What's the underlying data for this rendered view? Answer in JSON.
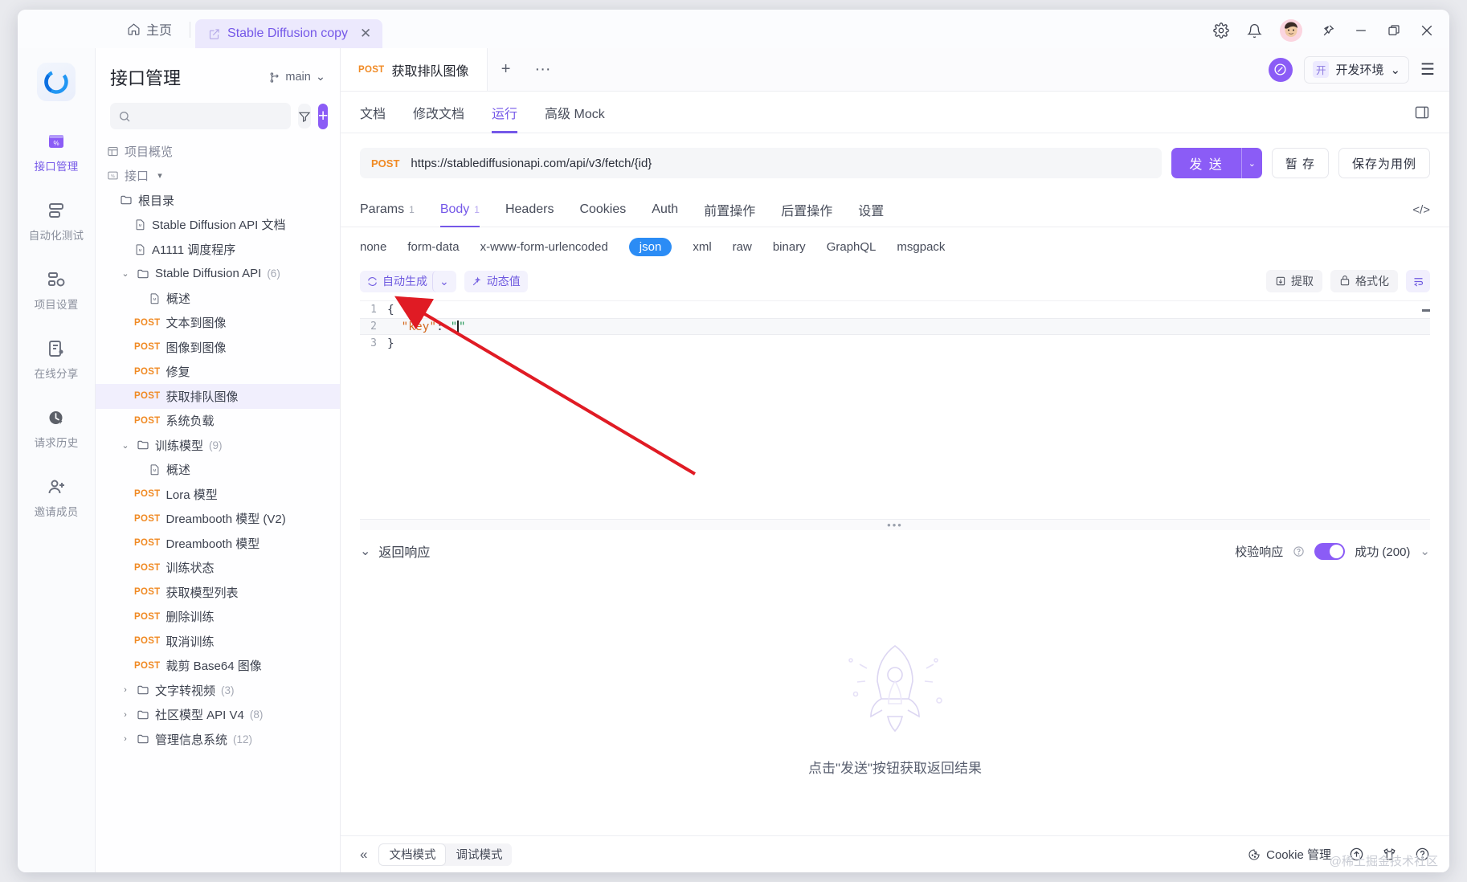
{
  "titlebar": {
    "home_tab": "主页",
    "doc_tab": "Stable Diffusion copy",
    "close_glyph": "✕",
    "icons": [
      "gear-icon",
      "bell-icon",
      "avatar",
      "pin-icon",
      "minimize-icon",
      "restore-icon",
      "close-icon"
    ]
  },
  "rail": {
    "items": [
      {
        "label": "接口管理",
        "icon": "api-manage-icon",
        "active": true
      },
      {
        "label": "自动化测试",
        "icon": "automation-test-icon",
        "active": false
      },
      {
        "label": "项目设置",
        "icon": "project-settings-icon",
        "active": false
      },
      {
        "label": "在线分享",
        "icon": "online-share-icon",
        "active": false
      },
      {
        "label": "请求历史",
        "icon": "request-history-icon",
        "active": false
      },
      {
        "label": "邀请成员",
        "icon": "invite-member-icon",
        "active": false
      }
    ]
  },
  "tree": {
    "title": "接口管理",
    "branch": "main",
    "search_placeholder": "",
    "search_value": "",
    "overview_label": "项目概览",
    "interface_label": "接口",
    "nodes": [
      {
        "type": "folder",
        "label": "根目录",
        "indent": 2,
        "caret": "",
        "count": ""
      },
      {
        "type": "doc",
        "label": "Stable Diffusion API 文档",
        "indent": 3,
        "caret": "",
        "count": ""
      },
      {
        "type": "doc",
        "label": "A1111 调度程序",
        "indent": 3,
        "caret": "",
        "count": ""
      },
      {
        "type": "folder",
        "label": "Stable Diffusion API",
        "indent": 2,
        "caret": "⌄",
        "count": "(6)"
      },
      {
        "type": "doc",
        "label": "概述",
        "indent": 4,
        "caret": "",
        "count": ""
      },
      {
        "type": "api",
        "label": "文本到图像",
        "indent": 3,
        "method": "POST",
        "count": ""
      },
      {
        "type": "api",
        "label": "图像到图像",
        "indent": 3,
        "method": "POST",
        "count": ""
      },
      {
        "type": "api",
        "label": "修复",
        "indent": 3,
        "method": "POST",
        "count": ""
      },
      {
        "type": "api",
        "label": "获取排队图像",
        "indent": 3,
        "method": "POST",
        "count": "",
        "selected": true
      },
      {
        "type": "api",
        "label": "系统负载",
        "indent": 3,
        "method": "POST",
        "count": ""
      },
      {
        "type": "folder",
        "label": "训练模型",
        "indent": 2,
        "caret": "⌄",
        "count": "(9)"
      },
      {
        "type": "doc",
        "label": "概述",
        "indent": 4,
        "caret": "",
        "count": ""
      },
      {
        "type": "api",
        "label": "Lora 模型",
        "indent": 3,
        "method": "POST",
        "count": ""
      },
      {
        "type": "api",
        "label": "Dreambooth 模型 (V2)",
        "indent": 3,
        "method": "POST",
        "count": ""
      },
      {
        "type": "api",
        "label": "Dreambooth 模型",
        "indent": 3,
        "method": "POST",
        "count": ""
      },
      {
        "type": "api",
        "label": "训练状态",
        "indent": 3,
        "method": "POST",
        "count": ""
      },
      {
        "type": "api",
        "label": "获取模型列表",
        "indent": 3,
        "method": "POST",
        "count": ""
      },
      {
        "type": "api",
        "label": "删除训练",
        "indent": 3,
        "method": "POST",
        "count": ""
      },
      {
        "type": "api",
        "label": "取消训练",
        "indent": 3,
        "method": "POST",
        "count": ""
      },
      {
        "type": "api",
        "label": "裁剪 Base64 图像",
        "indent": 3,
        "method": "POST",
        "count": ""
      },
      {
        "type": "folder",
        "label": "文字转视频",
        "indent": 2,
        "caret": "›",
        "count": "(3)"
      },
      {
        "type": "folder",
        "label": "社区模型 API V4",
        "indent": 2,
        "caret": "›",
        "count": "(8)"
      },
      {
        "type": "folder",
        "label": "管理信息系统",
        "indent": 2,
        "caret": "›",
        "count": "(12)"
      }
    ]
  },
  "main": {
    "api_tab": {
      "method": "POST",
      "title": "获取排队图像"
    },
    "add_tab_glyph": "+",
    "more_glyph": "···",
    "env": {
      "tag": "开",
      "name": "开发环境",
      "caret": "⌄"
    },
    "menu_glyph": "☰",
    "sub_tabs": [
      {
        "label": "文档",
        "active": false
      },
      {
        "label": "修改文档",
        "active": false
      },
      {
        "label": "运行",
        "active": true
      },
      {
        "label": "高级 Mock",
        "active": false
      }
    ],
    "url": {
      "method": "POST",
      "value": "https://stablediffusionapi.com/api/v3/fetch/{id}"
    },
    "actions": {
      "send": "发 送",
      "send_caret": "⌄",
      "save_temp": "暂 存",
      "save_as_case": "保存为用例"
    },
    "req_tabs": [
      {
        "label": "Params",
        "badge": "1",
        "active": false
      },
      {
        "label": "Body",
        "badge": "1",
        "active": true
      },
      {
        "label": "Headers",
        "badge": "",
        "active": false
      },
      {
        "label": "Cookies",
        "badge": "",
        "active": false
      },
      {
        "label": "Auth",
        "badge": "",
        "active": false
      },
      {
        "label": "前置操作",
        "badge": "",
        "active": false
      },
      {
        "label": "后置操作",
        "badge": "",
        "active": false
      },
      {
        "label": "设置",
        "badge": "",
        "active": false
      }
    ],
    "code_toggle": "</>",
    "body_types": [
      {
        "label": "none",
        "selected": false
      },
      {
        "label": "form-data",
        "selected": false
      },
      {
        "label": "x-www-form-urlencoded",
        "selected": false
      },
      {
        "label": "json",
        "selected": true
      },
      {
        "label": "xml",
        "selected": false
      },
      {
        "label": "raw",
        "selected": false
      },
      {
        "label": "binary",
        "selected": false
      },
      {
        "label": "GraphQL",
        "selected": false
      },
      {
        "label": "msgpack",
        "selected": false
      }
    ],
    "editor_toolbar": {
      "auto_generate": "自动生成",
      "auto_generate_caret": "⌄",
      "dynamic_value": "动态值",
      "extract": "提取",
      "format": "格式化",
      "wrap_icon": "wrap-lines-icon"
    },
    "code_lines": [
      {
        "n": "1",
        "text": "{"
      },
      {
        "n": "2",
        "text": "  \"key\": \"\"",
        "current": true
      },
      {
        "n": "3",
        "text": "}"
      }
    ],
    "code_json": "{\n  \"key\": \"\"\n}"
  },
  "response": {
    "caret": "⌄",
    "title": "返回响应",
    "validate_label": "校验响应",
    "help_glyph": "?",
    "toggle_on": true,
    "status": "成功 (200)",
    "status_caret": "⌄",
    "empty_text": "点击\"发送\"按钮获取返回结果",
    "splitter_glyph": "•••"
  },
  "bottombar": {
    "collapse_glyph": "«",
    "modes": [
      {
        "label": "文档模式",
        "on": true
      },
      {
        "label": "调试模式",
        "on": false
      }
    ],
    "cookie_label": "Cookie 管理",
    "icons": [
      "upload-circle-icon",
      "shirt-icon",
      "help-circle-icon"
    ],
    "watermark": "@稀土掘金技术社区"
  },
  "colors": {
    "accent_purple": "#8b5cf6",
    "method_orange": "#f08a24",
    "json_blue": "#2b8cf5",
    "annotation_red": "#e01b24"
  }
}
